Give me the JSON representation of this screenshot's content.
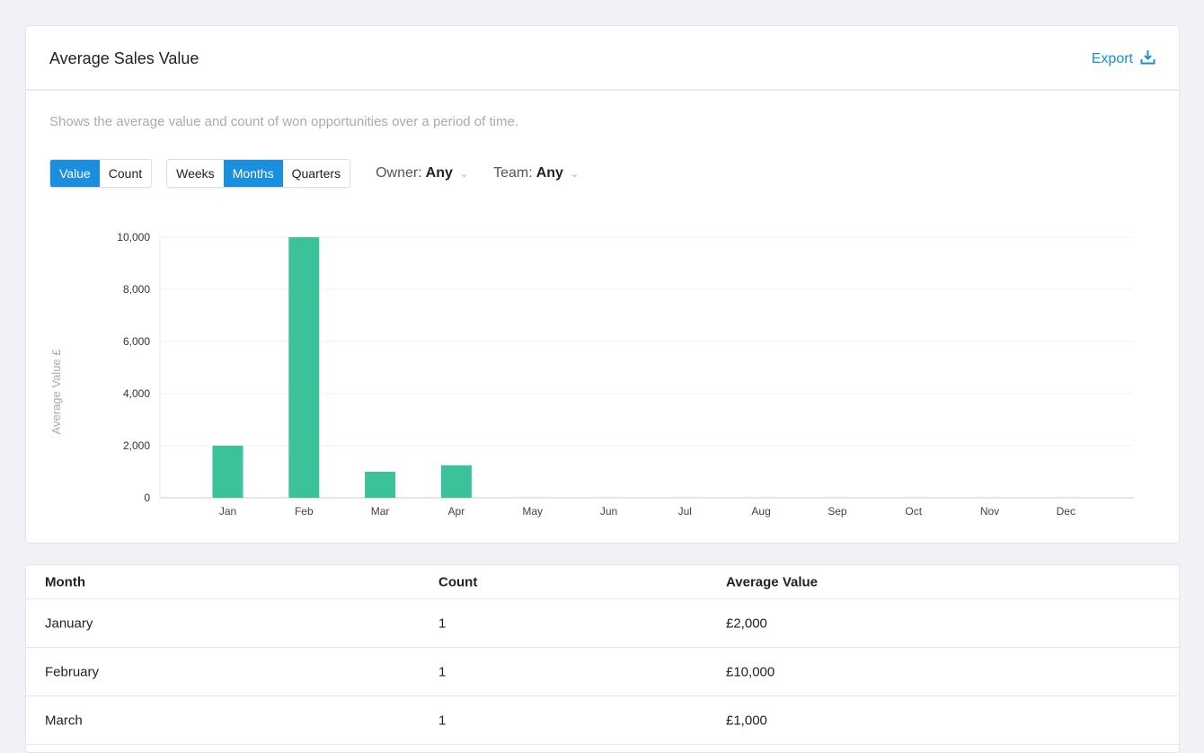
{
  "card": {
    "title": "Average Sales Value",
    "export_label": "Export",
    "description": "Shows the average value and count of won opportunities over a period of time."
  },
  "controls": {
    "metric": [
      {
        "label": "Value",
        "active": true
      },
      {
        "label": "Count",
        "active": false
      }
    ],
    "period": [
      {
        "label": "Weeks",
        "active": false
      },
      {
        "label": "Months",
        "active": true
      },
      {
        "label": "Quarters",
        "active": false
      }
    ],
    "owner": {
      "label": "Owner:",
      "value": "Any"
    },
    "team": {
      "label": "Team:",
      "value": "Any"
    }
  },
  "colors": {
    "accent": "#1a8fe0",
    "bar": "#3cc29a"
  },
  "chart_data": {
    "type": "bar",
    "title": "",
    "xlabel": "",
    "ylabel": "Average Value £",
    "categories": [
      "Jan",
      "Feb",
      "Mar",
      "Apr",
      "May",
      "Jun",
      "Jul",
      "Aug",
      "Sep",
      "Oct",
      "Nov",
      "Dec"
    ],
    "values": [
      2000,
      10000,
      1000,
      1250,
      0,
      0,
      0,
      0,
      0,
      0,
      0,
      0
    ],
    "ylim": [
      0,
      10000
    ],
    "yticks": [
      0,
      2000,
      4000,
      6000,
      8000,
      10000
    ],
    "ytick_labels": [
      "0",
      "2,000",
      "4,000",
      "6,000",
      "8,000",
      "10,000"
    ],
    "grid": true,
    "legend": "none"
  },
  "table": {
    "headers": [
      "Month",
      "Count",
      "Average Value"
    ],
    "rows": [
      [
        "January",
        "1",
        "£2,000"
      ],
      [
        "February",
        "1",
        "£10,000"
      ],
      [
        "March",
        "1",
        "£1,000"
      ]
    ]
  }
}
